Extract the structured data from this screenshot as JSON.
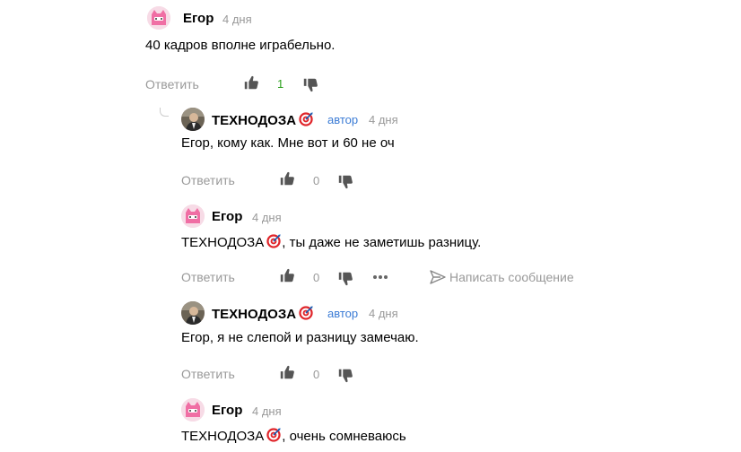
{
  "comments": [
    {
      "author": "Егор",
      "time": "4 дня",
      "text": "40 кадров вполне играбельно.",
      "reply_label": "Ответить",
      "likes": "1"
    },
    {
      "author": "ТЕХНОДОЗА",
      "role": "автор",
      "time": "4 дня",
      "text": "Егор, кому как. Мне вот и 60 не оч",
      "reply_label": "Ответить",
      "likes": "0"
    },
    {
      "author": "Егор",
      "time": "4 дня",
      "mention": "ТЕХНОДОЗА",
      "text": ", ты даже не заметишь разницу.",
      "reply_label": "Ответить",
      "likes": "0",
      "write_message": "Написать сообщение"
    },
    {
      "author": "ТЕХНОДОЗА",
      "role": "автор",
      "time": "4 дня",
      "text": "Егор, я не слепой и разницу замечаю.",
      "reply_label": "Ответить",
      "likes": "0"
    },
    {
      "author": "Егор",
      "time": "4 дня",
      "mention": "ТЕХНОДОЗА",
      "text": ", очень сомневаюсь"
    }
  ],
  "colors": {
    "positive_count": "#2ca01c",
    "role_link": "#3a7bd5",
    "muted": "#999999"
  }
}
